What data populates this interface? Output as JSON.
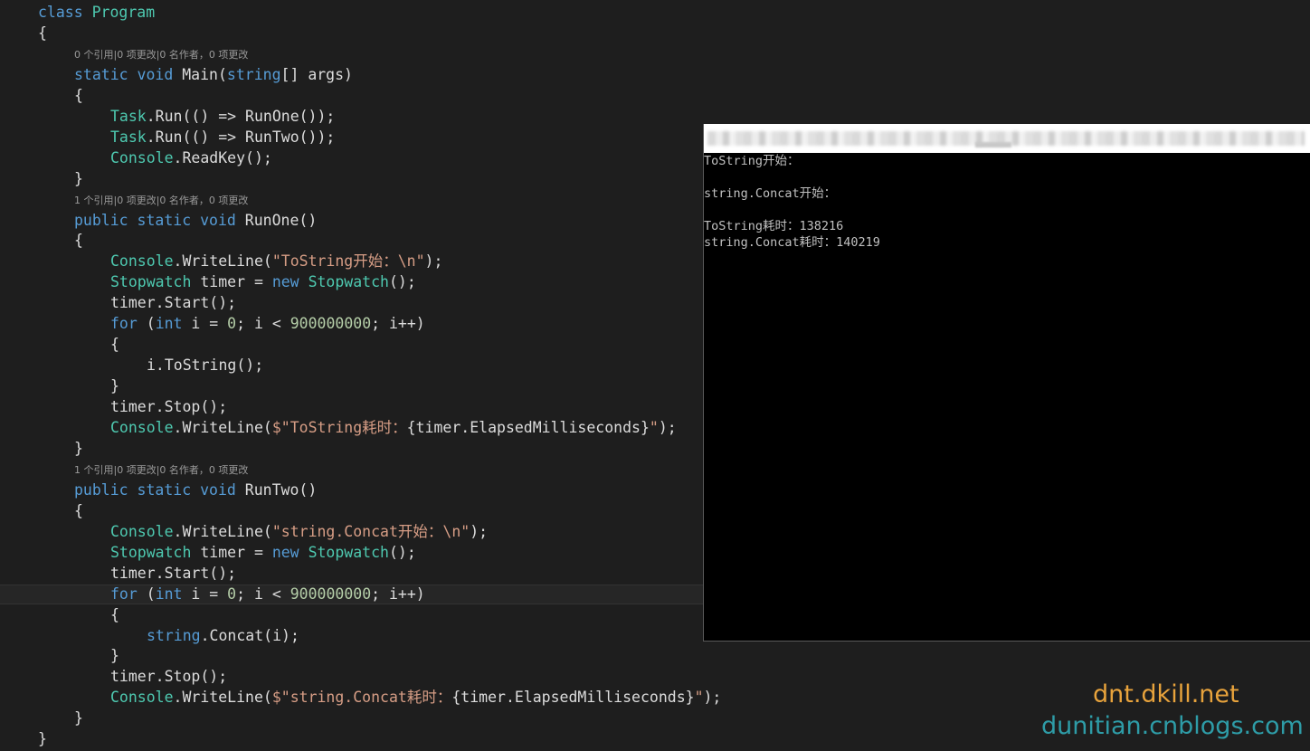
{
  "colors": {
    "background": "#1e1e1e",
    "keyword": "#569cd6",
    "type": "#4ec9b0",
    "string": "#d69d85",
    "number": "#b5cea8",
    "plain": "#dcdcdc",
    "codelens": "#9a9a9a",
    "console_bg": "#000000",
    "console_text": "#c0c0c0",
    "watermark_1": "#e8a33c",
    "watermark_2": "#2e9ca7"
  },
  "editor": {
    "lines": [
      {
        "indent": 1,
        "tokens": [
          [
            "class",
            "kw"
          ],
          [
            " ",
            "p"
          ],
          [
            "Program",
            "ty"
          ]
        ]
      },
      {
        "indent": 1,
        "tokens": [
          [
            "{",
            "p"
          ]
        ]
      },
      {
        "indent": 2,
        "tokens": [
          [
            "static",
            "kw"
          ],
          [
            " ",
            "p"
          ],
          [
            "void",
            "kw"
          ],
          [
            " Main(",
            "p"
          ],
          [
            "string",
            "kw"
          ],
          [
            "[] args)",
            "p"
          ]
        ]
      },
      {
        "indent": 2,
        "tokens": [
          [
            "{",
            "p"
          ]
        ]
      },
      {
        "indent": 3,
        "tokens": [
          [
            "Task",
            "ty"
          ],
          [
            ".Run(() => RunOne());",
            "p"
          ]
        ]
      },
      {
        "indent": 3,
        "tokens": [
          [
            "Task",
            "ty"
          ],
          [
            ".Run(() => RunTwo());",
            "p"
          ]
        ]
      },
      {
        "indent": 3,
        "tokens": [
          [
            "Console",
            "ty"
          ],
          [
            ".ReadKey();",
            "p"
          ]
        ]
      },
      {
        "indent": 2,
        "tokens": [
          [
            "}",
            "p"
          ]
        ]
      },
      {
        "indent": 2,
        "tokens": [
          [
            "public",
            "kw"
          ],
          [
            " ",
            "p"
          ],
          [
            "static",
            "kw"
          ],
          [
            " ",
            "p"
          ],
          [
            "void",
            "kw"
          ],
          [
            " RunOne()",
            "p"
          ]
        ]
      },
      {
        "indent": 2,
        "tokens": [
          [
            "{",
            "p"
          ]
        ]
      },
      {
        "indent": 3,
        "tokens": [
          [
            "Console",
            "ty"
          ],
          [
            ".WriteLine(",
            "p"
          ],
          [
            "\"ToString开始：\\n\"",
            "str"
          ],
          [
            ");",
            "p"
          ]
        ]
      },
      {
        "indent": 3,
        "tokens": [
          [
            "Stopwatch",
            "ty"
          ],
          [
            " timer = ",
            "p"
          ],
          [
            "new",
            "kw"
          ],
          [
            " ",
            "p"
          ],
          [
            "Stopwatch",
            "ty"
          ],
          [
            "();",
            "p"
          ]
        ]
      },
      {
        "indent": 3,
        "tokens": [
          [
            "timer.Start();",
            "p"
          ]
        ]
      },
      {
        "indent": 3,
        "tokens": [
          [
            "for",
            "kw"
          ],
          [
            " (",
            "p"
          ],
          [
            "int",
            "kw"
          ],
          [
            " i = ",
            "p"
          ],
          [
            "0",
            "num"
          ],
          [
            "; i < ",
            "p"
          ],
          [
            "900000000",
            "num"
          ],
          [
            "; i++)",
            "p"
          ]
        ]
      },
      {
        "indent": 3,
        "tokens": [
          [
            "{",
            "p"
          ]
        ]
      },
      {
        "indent": 4,
        "tokens": [
          [
            "i.ToString();",
            "p"
          ]
        ]
      },
      {
        "indent": 3,
        "tokens": [
          [
            "}",
            "p"
          ]
        ]
      },
      {
        "indent": 3,
        "tokens": [
          [
            "timer.Stop();",
            "p"
          ]
        ]
      },
      {
        "indent": 3,
        "tokens": [
          [
            "Console",
            "ty"
          ],
          [
            ".WriteLine(",
            "p"
          ],
          [
            "$\"ToString耗时：",
            "str"
          ],
          [
            "{timer.ElapsedMilliseconds}",
            "p"
          ],
          [
            "\"",
            "str"
          ],
          [
            ");",
            "p"
          ]
        ]
      },
      {
        "indent": 2,
        "tokens": [
          [
            "}",
            "p"
          ]
        ]
      },
      {
        "indent": 2,
        "tokens": [
          [
            "public",
            "kw"
          ],
          [
            " ",
            "p"
          ],
          [
            "static",
            "kw"
          ],
          [
            " ",
            "p"
          ],
          [
            "void",
            "kw"
          ],
          [
            " RunTwo()",
            "p"
          ]
        ]
      },
      {
        "indent": 2,
        "tokens": [
          [
            "{",
            "p"
          ]
        ]
      },
      {
        "indent": 3,
        "tokens": [
          [
            "Console",
            "ty"
          ],
          [
            ".WriteLine(",
            "p"
          ],
          [
            "\"string.Concat开始：\\n\"",
            "str"
          ],
          [
            ");",
            "p"
          ]
        ]
      },
      {
        "indent": 3,
        "tokens": [
          [
            "Stopwatch",
            "ty"
          ],
          [
            " timer = ",
            "p"
          ],
          [
            "new",
            "kw"
          ],
          [
            " ",
            "p"
          ],
          [
            "Stopwatch",
            "ty"
          ],
          [
            "();",
            "p"
          ]
        ]
      },
      {
        "indent": 3,
        "tokens": [
          [
            "timer.Start();",
            "p"
          ]
        ]
      },
      {
        "indent": 3,
        "current": true,
        "tokens": [
          [
            "for",
            "kw"
          ],
          [
            " (",
            "p"
          ],
          [
            "int",
            "kw"
          ],
          [
            " i = ",
            "p"
          ],
          [
            "0",
            "num"
          ],
          [
            "; i < ",
            "p"
          ],
          [
            "900000000",
            "num"
          ],
          [
            "; i++)",
            "p"
          ]
        ]
      },
      {
        "indent": 3,
        "tokens": [
          [
            "{",
            "p"
          ]
        ]
      },
      {
        "indent": 4,
        "tokens": [
          [
            "string",
            "kw"
          ],
          [
            ".Concat(i);",
            "p"
          ]
        ]
      },
      {
        "indent": 3,
        "tokens": [
          [
            "}",
            "p"
          ]
        ]
      },
      {
        "indent": 3,
        "tokens": [
          [
            "timer.Stop();",
            "p"
          ]
        ]
      },
      {
        "indent": 3,
        "tokens": [
          [
            "Console",
            "ty"
          ],
          [
            ".WriteLine(",
            "p"
          ],
          [
            "$\"string.Concat耗时：",
            "str"
          ],
          [
            "{timer.ElapsedMilliseconds}",
            "p"
          ],
          [
            "\"",
            "str"
          ],
          [
            ");",
            "p"
          ]
        ]
      },
      {
        "indent": 2,
        "tokens": [
          [
            "}",
            "p"
          ]
        ]
      },
      {
        "indent": 1,
        "tokens": [
          [
            "}",
            "p"
          ]
        ]
      },
      {
        "indent": 0,
        "tokens": [
          [
            "}",
            "p"
          ]
        ]
      }
    ],
    "codelens": [
      {
        "before_line": 2,
        "text": "0 个引用|0 项更改|0 名作者，0 项更改"
      },
      {
        "before_line": 8,
        "text": "1 个引用|0 项更改|0 名作者，0 项更改"
      },
      {
        "before_line": 20,
        "text": "1 个引用|0 项更改|0 名作者，0 项更改"
      }
    ]
  },
  "console": {
    "lines": [
      "ToString开始：",
      "",
      "string.Concat开始：",
      "",
      "ToString耗时：138216",
      "string.Concat耗时：140219"
    ]
  },
  "watermark": {
    "line1": "dnt.dkill.net",
    "line2": "dunitian.cnblogs.com"
  }
}
